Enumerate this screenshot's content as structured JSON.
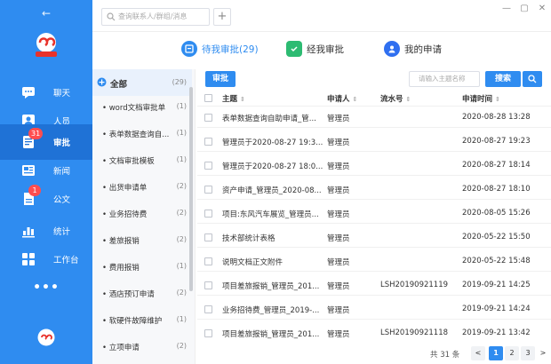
{
  "window": {
    "minimize": "—",
    "maximize": "▢",
    "close": "✕"
  },
  "nav": {
    "back": "←",
    "items": [
      {
        "label": "聊天",
        "badge": ""
      },
      {
        "label": "人员",
        "badge": ""
      },
      {
        "label": "审批",
        "badge": "31"
      },
      {
        "label": "新闻",
        "badge": ""
      },
      {
        "label": "公文",
        "badge": "1"
      },
      {
        "label": "统计",
        "badge": ""
      },
      {
        "label": "工作台",
        "badge": ""
      }
    ],
    "more": "•••"
  },
  "topbar": {
    "search_placeholder": "查询联系人/群组/消息",
    "add": "+"
  },
  "tabs": [
    {
      "label": "待我审批(29)",
      "active": true
    },
    {
      "label": "经我审批",
      "active": false
    },
    {
      "label": "我的申请",
      "active": false
    }
  ],
  "categories": {
    "all": {
      "label": "全部",
      "count": "(29)"
    },
    "items": [
      {
        "label": "• word文档审批单",
        "count": "(1)"
      },
      {
        "label": "• 表单数据查询自...",
        "count": "(1)"
      },
      {
        "label": "• 文档审批模板",
        "count": "(1)"
      },
      {
        "label": "• 出货申请单",
        "count": "(2)"
      },
      {
        "label": "• 业务招待费",
        "count": "(2)"
      },
      {
        "label": "• 差旅报销",
        "count": "(2)"
      },
      {
        "label": "• 费用报销",
        "count": "(1)"
      },
      {
        "label": "• 酒店预订申请",
        "count": "(2)"
      },
      {
        "label": "• 软硬件故障维护",
        "count": "(1)"
      },
      {
        "label": "• 立项申请",
        "count": "(2)"
      }
    ]
  },
  "toolbar": {
    "audit": "审批",
    "subject_placeholder": "请输入主题名称",
    "search": "搜索"
  },
  "table": {
    "headers": {
      "subject": "主题",
      "applicant": "申请人",
      "serial": "流水号",
      "time": "申请时间",
      "sort": "⇕"
    },
    "rows": [
      {
        "subject": "表单数据查询自助申请_管...",
        "applicant": "管理员",
        "serial": "",
        "time": "2020-08-28 13:28"
      },
      {
        "subject": "管理员于2020-08-27 19:3...",
        "applicant": "管理员",
        "serial": "",
        "time": "2020-08-27 19:23"
      },
      {
        "subject": "管理员于2020-08-27 18:0...",
        "applicant": "管理员",
        "serial": "",
        "time": "2020-08-27 18:14"
      },
      {
        "subject": "资产申请_管理员_2020-08...",
        "applicant": "管理员",
        "serial": "",
        "time": "2020-08-27 18:10"
      },
      {
        "subject": "项目:东风汽车展览_管理员...",
        "applicant": "管理员",
        "serial": "",
        "time": "2020-08-05 15:26"
      },
      {
        "subject": "技术部统计表格",
        "applicant": "管理员",
        "serial": "",
        "time": "2020-05-22 15:50"
      },
      {
        "subject": "说明文档正文附件",
        "applicant": "管理员",
        "serial": "",
        "time": "2020-05-22 15:48"
      },
      {
        "subject": "项目差旅报销_管理员_201...",
        "applicant": "管理员",
        "serial": "LSH20190921119",
        "time": "2019-09-21 14:25"
      },
      {
        "subject": "业务招待费_管理员_2019-...",
        "applicant": "管理员",
        "serial": "",
        "time": "2019-09-21 14:24"
      },
      {
        "subject": "项目差旅报销_管理员_201...",
        "applicant": "管理员",
        "serial": "LSH20190921118",
        "time": "2019-09-21 13:42"
      }
    ]
  },
  "pagination": {
    "total": "共 31 条",
    "prev": "<",
    "pages": [
      "1",
      "2",
      "3"
    ],
    "next": ">"
  },
  "colors": {
    "primary": "#2f8cf0",
    "badge": "#ff4d4f",
    "tab_green": "#2dbb72",
    "tab_blue": "#2f6ff0"
  }
}
